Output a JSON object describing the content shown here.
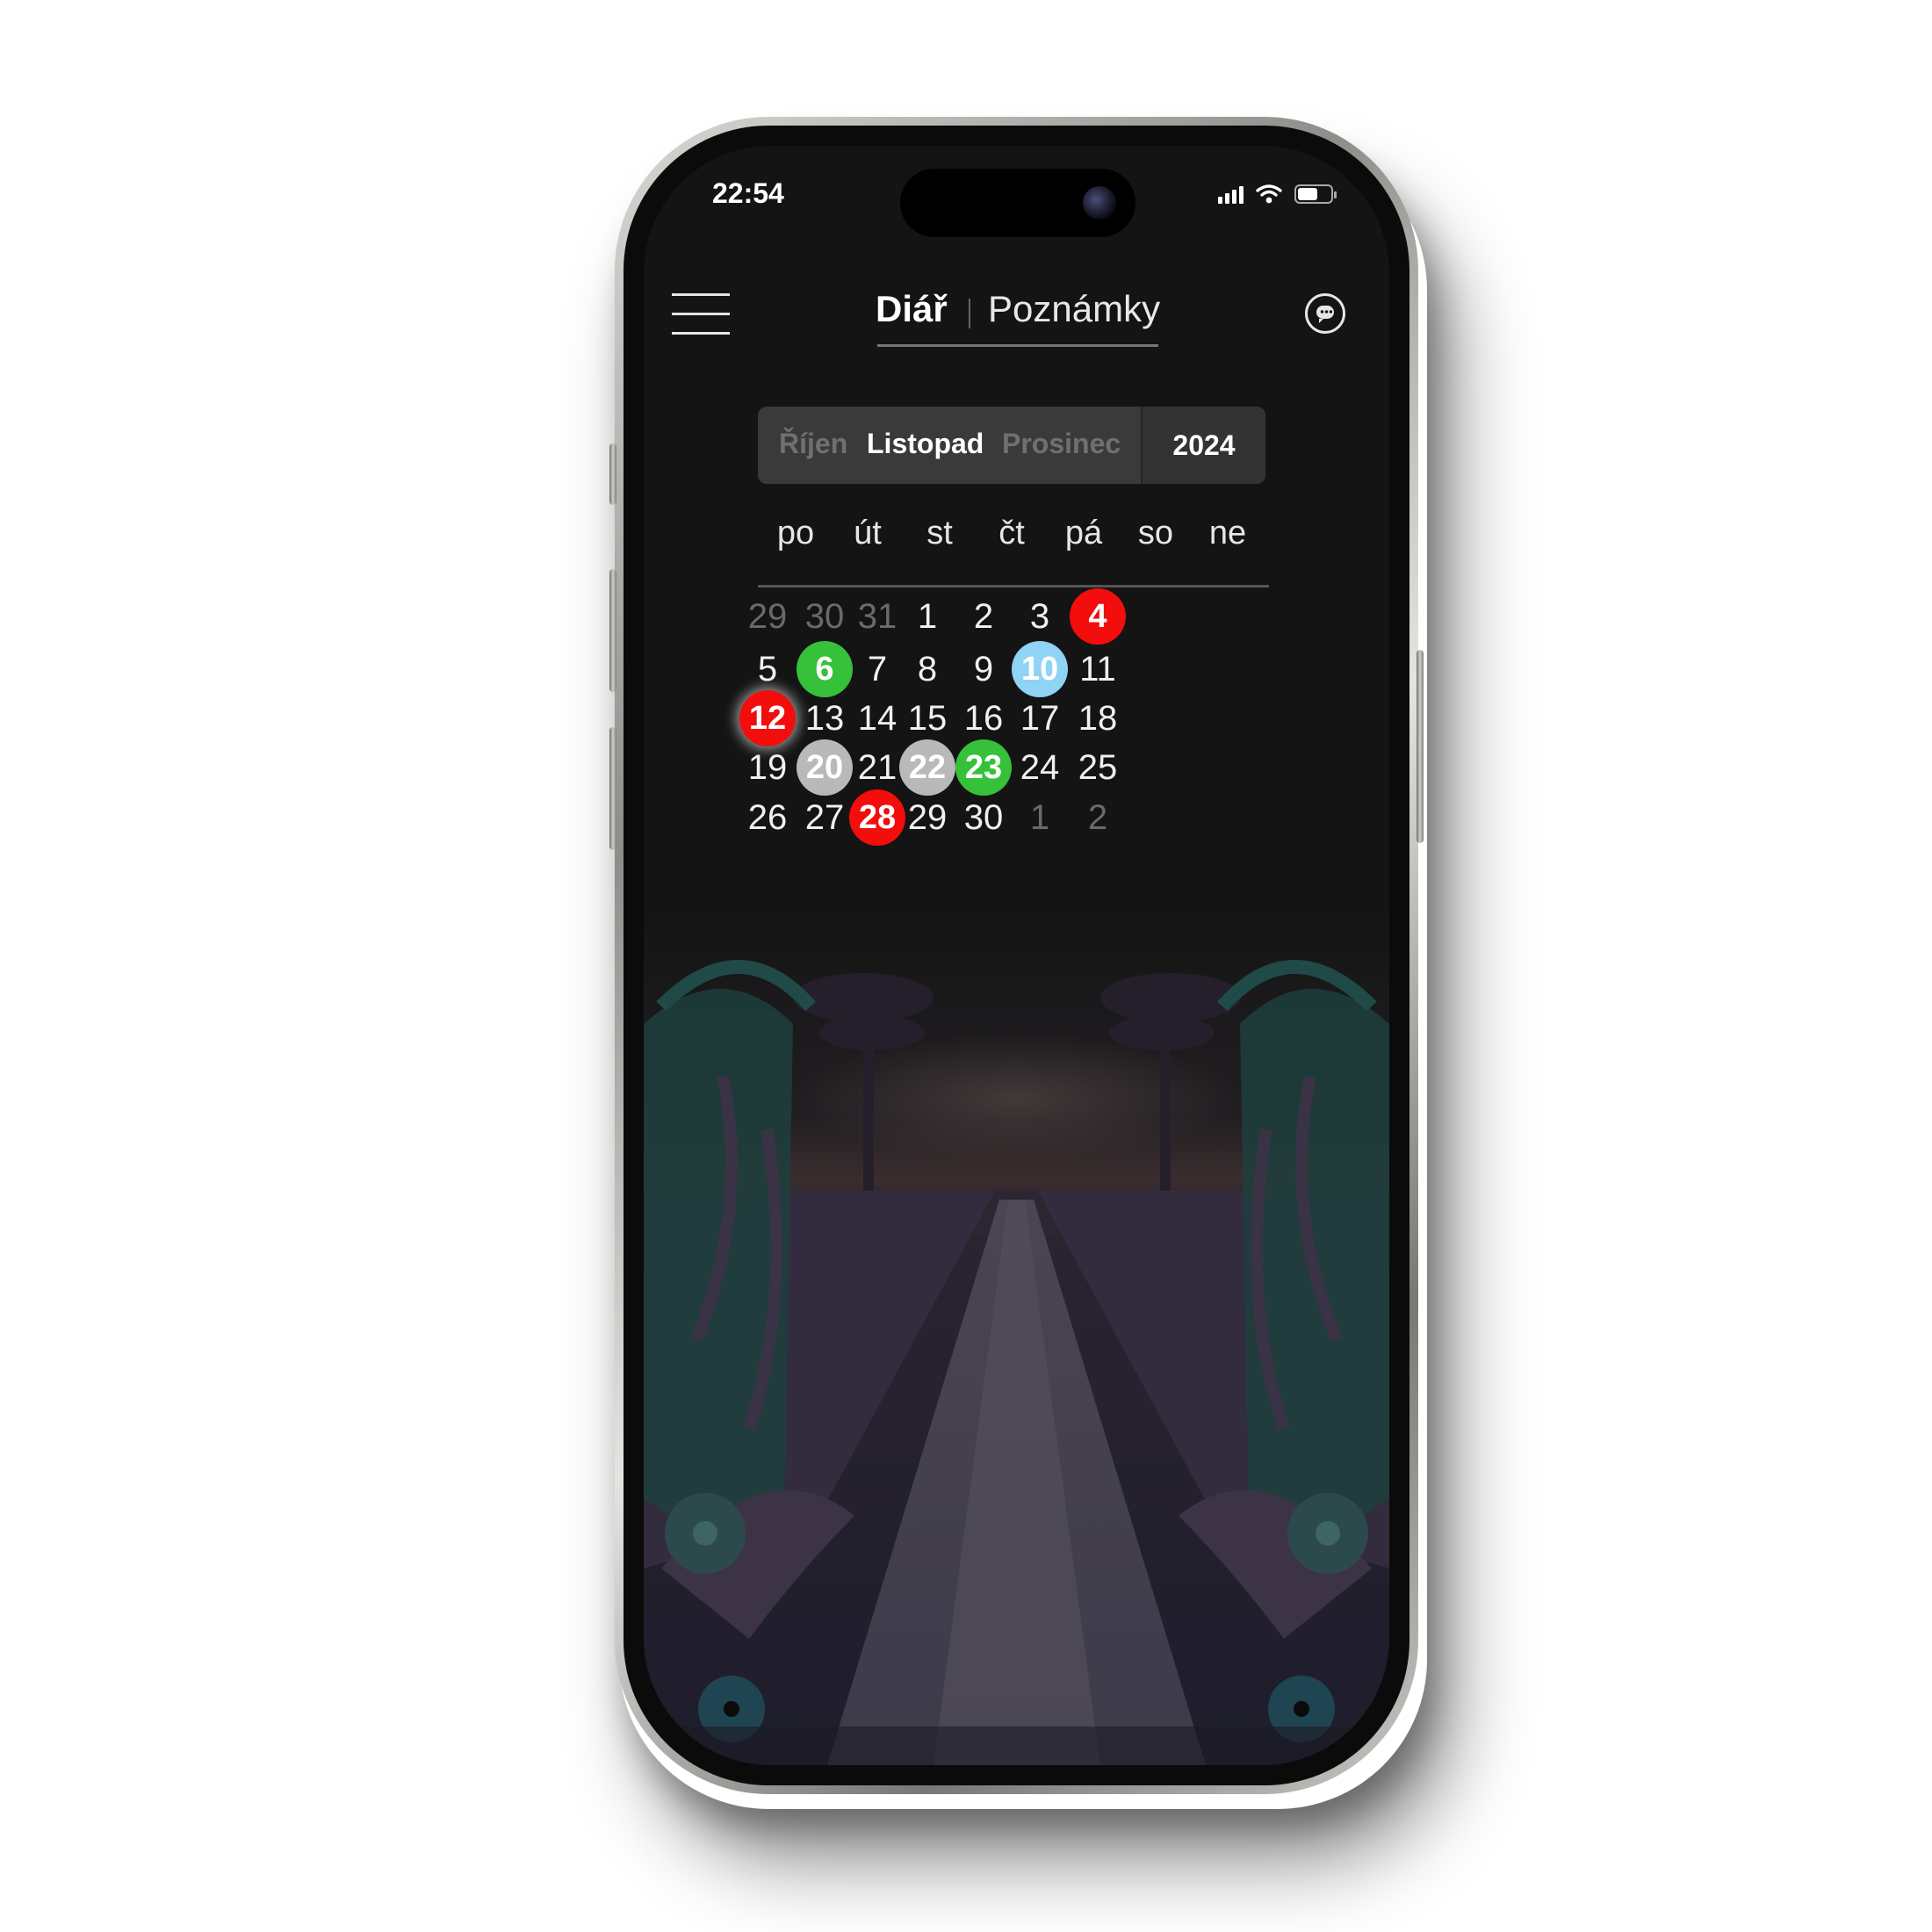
{
  "status_bar": {
    "time": "22:54"
  },
  "header": {
    "tab_active": "Diář",
    "tab_inactive": "Poznámky"
  },
  "month_picker": {
    "prev": "Říjen",
    "current": "Listopad",
    "next": "Prosinec",
    "year": "2024"
  },
  "weekdays": [
    "po",
    "út",
    "st",
    "čt",
    "pá",
    "so",
    "ne"
  ],
  "calendar": {
    "rows": [
      [
        {
          "d": "29",
          "state": "out"
        },
        {
          "d": "30",
          "state": "out"
        },
        {
          "d": "31",
          "state": "out"
        },
        {
          "d": "1",
          "state": ""
        },
        {
          "d": "2",
          "state": ""
        },
        {
          "d": "3",
          "state": ""
        },
        {
          "d": "4",
          "state": "red"
        }
      ],
      [
        {
          "d": "5",
          "state": ""
        },
        {
          "d": "6",
          "state": "green"
        },
        {
          "d": "7",
          "state": ""
        },
        {
          "d": "8",
          "state": ""
        },
        {
          "d": "9",
          "state": ""
        },
        {
          "d": "10",
          "state": "blue"
        },
        {
          "d": "11",
          "state": ""
        }
      ],
      [
        {
          "d": "12",
          "state": "red today"
        },
        {
          "d": "13",
          "state": ""
        },
        {
          "d": "14",
          "state": ""
        },
        {
          "d": "15",
          "state": ""
        },
        {
          "d": "16",
          "state": ""
        },
        {
          "d": "17",
          "state": ""
        },
        {
          "d": "18",
          "state": ""
        }
      ],
      [
        {
          "d": "19",
          "state": ""
        },
        {
          "d": "20",
          "state": "gray"
        },
        {
          "d": "21",
          "state": ""
        },
        {
          "d": "22",
          "state": "gray"
        },
        {
          "d": "23",
          "state": "green"
        },
        {
          "d": "24",
          "state": ""
        },
        {
          "d": "25",
          "state": ""
        }
      ],
      [
        {
          "d": "26",
          "state": ""
        },
        {
          "d": "27",
          "state": ""
        },
        {
          "d": "28",
          "state": "red"
        },
        {
          "d": "29",
          "state": ""
        },
        {
          "d": "30",
          "state": ""
        },
        {
          "d": "1",
          "state": "out"
        },
        {
          "d": "2",
          "state": "out"
        }
      ]
    ]
  },
  "colors": {
    "event_red": "#f30d0d",
    "event_green": "#36c13a",
    "event_blue": "#8fd3f5",
    "event_gray": "#b9b9b9",
    "background": "#141414"
  },
  "icons": {
    "menu": "hamburger-icon",
    "chat": "chat-bubble-icon"
  }
}
